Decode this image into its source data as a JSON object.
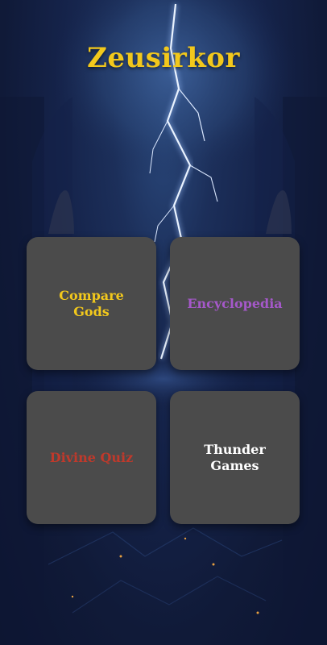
{
  "app": {
    "title": "Zeusirkor",
    "title_color": "#f2c81c"
  },
  "menu": {
    "tiles": [
      {
        "label": "Compare\nGods",
        "color": "#f2c81c"
      },
      {
        "label": "Encyclopedia",
        "color": "#a558c9"
      },
      {
        "label": "Divine Quiz",
        "color": "#c0392b"
      },
      {
        "label": "Thunder\nGames",
        "color": "#ffffff"
      }
    ]
  },
  "background": {
    "scene": "lightning-temple-backdrop",
    "colors": {
      "deep": "#0c1430",
      "mid": "#1c2f5a",
      "glow": "#cfe3ff",
      "ember": "#e8a040"
    }
  }
}
